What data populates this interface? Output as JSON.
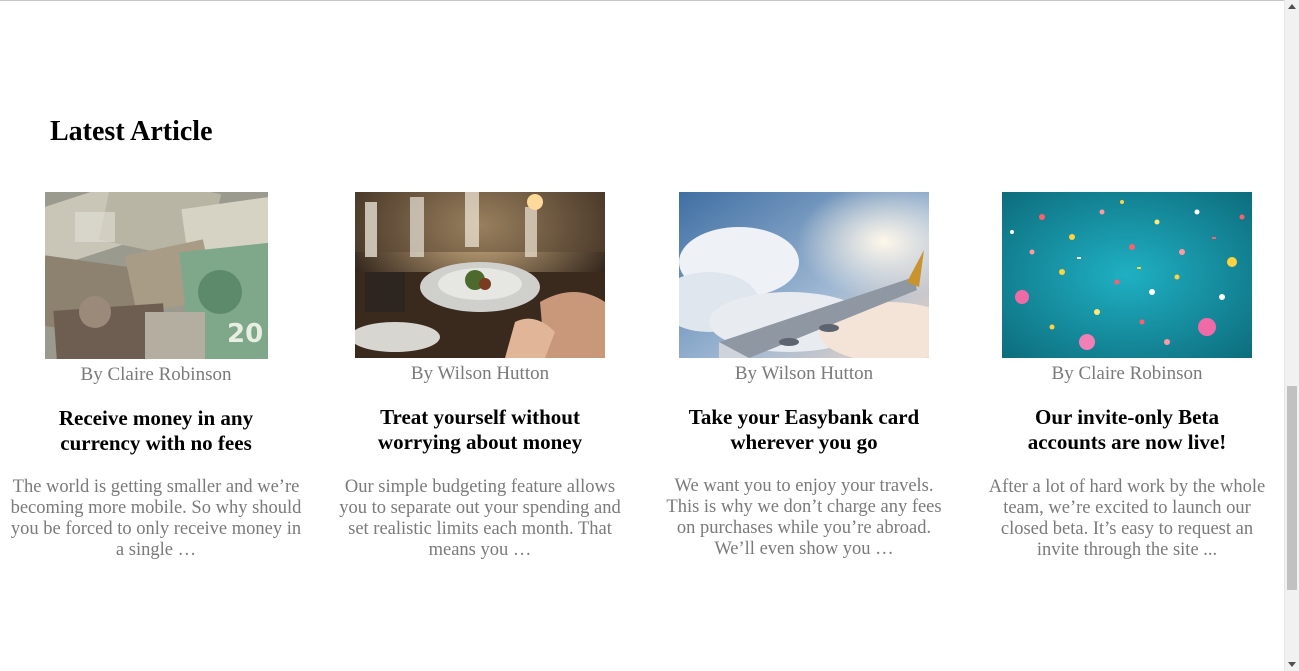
{
  "section": {
    "title": "Latest Article"
  },
  "articles": [
    {
      "author": "By Claire Robinson",
      "title": "Receive money in any currency with no fees",
      "excerpt": "The world is getting smaller and we’re becoming more mobile. So why should you be forced to only receive money in a single …",
      "image": "currency-banknotes-image"
    },
    {
      "author": "By Wilson Hutton",
      "title": "Treat yourself without worrying about money",
      "excerpt": "Our simple budgeting feature allows you to separate out your spending and set realistic limits each month. That means you …",
      "image": "restaurant-dinner-image"
    },
    {
      "author": "By Wilson Hutton",
      "title": "Take your Easybank card wherever you go",
      "excerpt": "We want you to enjoy your travels. This is why we don’t charge any fees on purchases while you’re abroad. We’ll even show you …",
      "image": "airplane-wing-clouds-image"
    },
    {
      "author": "By Claire Robinson",
      "title": "Our invite-only Beta accounts are now live!",
      "excerpt": "After a lot of hard work by the whole team, we’re excited to launch our closed beta. It’s easy to request an invite through the site ...",
      "image": "confetti-image"
    }
  ],
  "colors": {
    "heading": "#000000",
    "muted_text": "#7a7a7a",
    "background": "#ffffff"
  }
}
